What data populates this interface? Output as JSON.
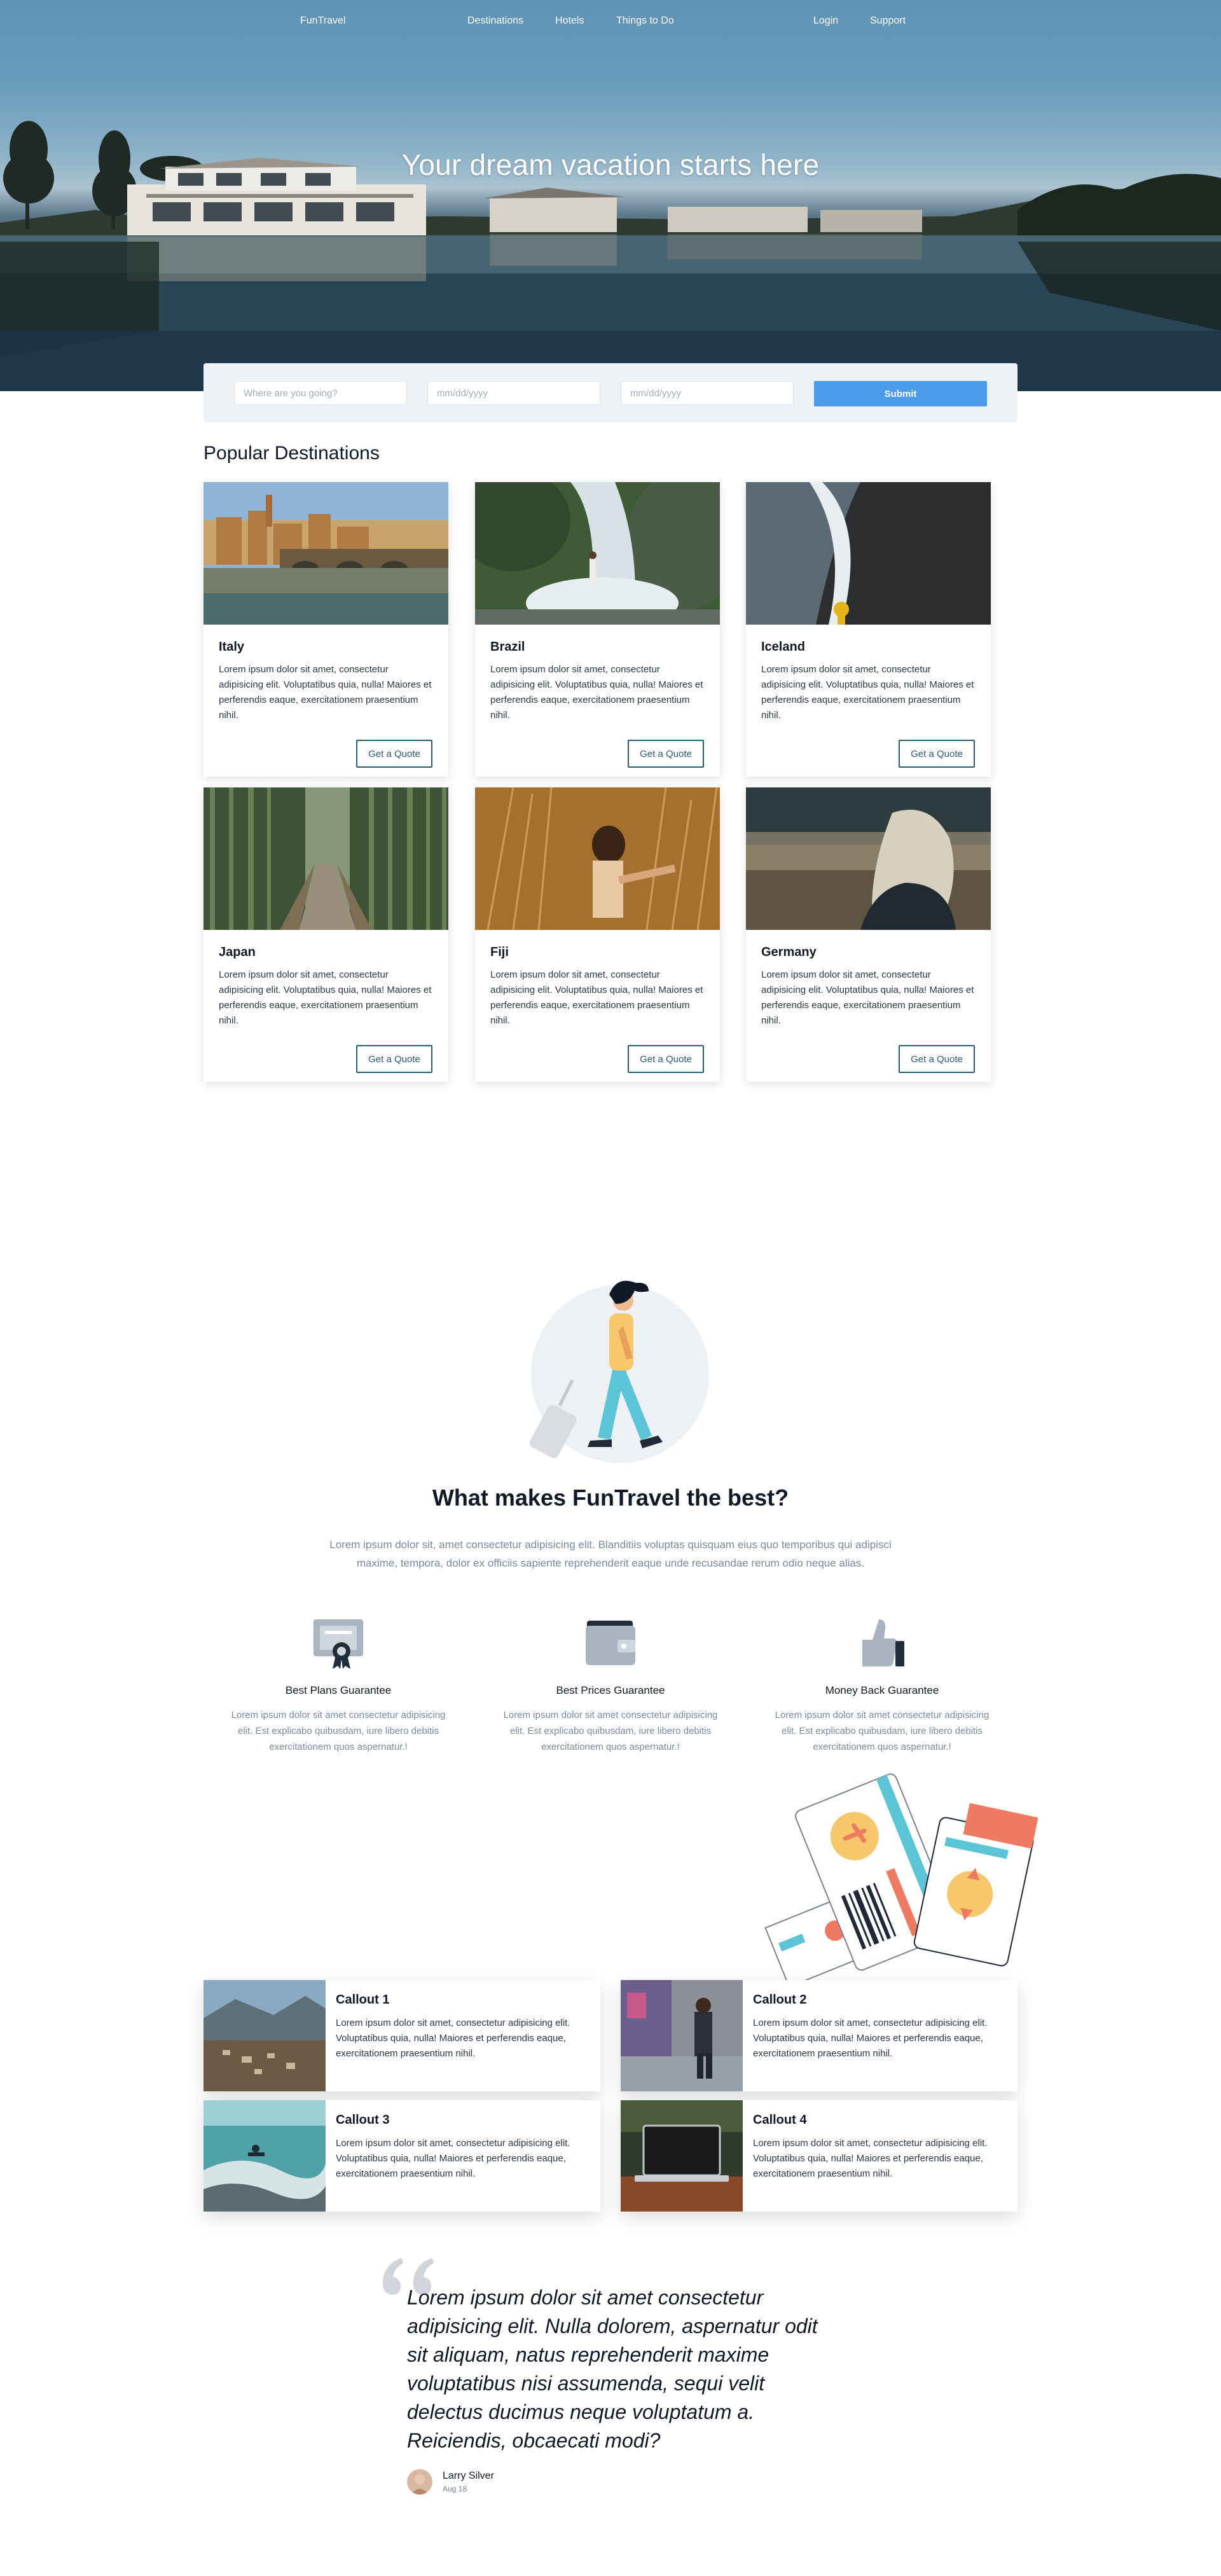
{
  "nav": {
    "brand": "FunTravel",
    "links": [
      "Destinations",
      "Hotels",
      "Things to Do"
    ],
    "right": [
      "Login",
      "Support"
    ]
  },
  "hero": {
    "title": "Your dream vacation starts here"
  },
  "search": {
    "where_placeholder": "Where are you going?",
    "checkin_placeholder": "mm/dd/yyyy",
    "checkout_placeholder": "mm/dd/yyyy",
    "submit_label": "Submit"
  },
  "destinations": {
    "title": "Popular Destinations",
    "button_label": "Get a Quote",
    "items": [
      {
        "name": "Italy",
        "text": "Lorem ipsum dolor sit amet, consectetur adipisicing elit. Voluptatibus quia, nulla! Maiores et perferendis eaque, exercitationem praesentium nihil."
      },
      {
        "name": "Brazil",
        "text": "Lorem ipsum dolor sit amet, consectetur adipisicing elit. Voluptatibus quia, nulla! Maiores et perferendis eaque, exercitationem praesentium nihil."
      },
      {
        "name": "Iceland",
        "text": "Lorem ipsum dolor sit amet, consectetur adipisicing elit. Voluptatibus quia, nulla! Maiores et perferendis eaque, exercitationem praesentium nihil."
      },
      {
        "name": "Japan",
        "text": "Lorem ipsum dolor sit amet, consectetur adipisicing elit. Voluptatibus quia, nulla! Maiores et perferendis eaque, exercitationem praesentium nihil."
      },
      {
        "name": "Fiji",
        "text": "Lorem ipsum dolor sit amet, consectetur adipisicing elit. Voluptatibus quia, nulla! Maiores et perferendis eaque, exercitationem praesentium nihil."
      },
      {
        "name": "Germany",
        "text": "Lorem ipsum dolor sit amet, consectetur adipisicing elit. Voluptatibus quia, nulla! Maiores et perferendis eaque, exercitationem praesentium nihil."
      }
    ]
  },
  "features": {
    "title": "What makes FunTravel the best?",
    "description": "Lorem ipsum dolor sit, amet consectetur adipisicing elit. Blanditiis voluptas quisquam eius quo temporibus qui adipisci maxime, tempora, dolor ex officiis sapiente reprehenderit eaque unde recusandae rerum odio neque alias.",
    "items": [
      {
        "title": "Best Plans Guarantee",
        "text": "Lorem ipsum dolor sit amet consectetur adipisicing elit. Est explicabo quibusdam, iure libero debitis exercitationem quos aspernatur.!",
        "icon": "certificate-icon"
      },
      {
        "title": "Best Prices Guarantee",
        "text": "Lorem ipsum dolor sit amet consectetur adipisicing elit. Est explicabo quibusdam, iure libero debitis exercitationem quos aspernatur.!",
        "icon": "wallet-icon"
      },
      {
        "title": "Money Back Guarantee",
        "text": "Lorem ipsum dolor sit amet consectetur adipisicing elit. Est explicabo quibusdam, iure libero debitis exercitationem quos aspernatur.!",
        "icon": "thumbs-up-icon"
      }
    ]
  },
  "callouts": [
    {
      "title": "Callout 1",
      "text": "Lorem ipsum dolor sit amet, consectetur adipisicing elit. Voluptatibus quia, nulla! Maiores et perferendis eaque, exercitationem praesentium nihil."
    },
    {
      "title": "Callout 2",
      "text": "Lorem ipsum dolor sit amet, consectetur adipisicing elit. Voluptatibus quia, nulla! Maiores et perferendis eaque, exercitationem praesentium nihil."
    },
    {
      "title": "Callout 3",
      "text": "Lorem ipsum dolor sit amet, consectetur adipisicing elit. Voluptatibus quia, nulla! Maiores et perferendis eaque, exercitationem praesentium nihil."
    },
    {
      "title": "Callout 4",
      "text": "Lorem ipsum dolor sit amet, consectetur adipisicing elit. Voluptatibus quia, nulla! Maiores et perferendis eaque, exercitationem praesentium nihil."
    }
  ],
  "testimonial": {
    "quote": "Lorem ipsum dolor sit amet consectetur adipisicing elit. Nulla dolorem, aspernatur odit sit aliquam, natus reprehenderit maxime voluptatibus nisi assumenda, sequi velit delectus ducimus neque voluptatum a. Reiciendis, obcaecati modi?",
    "author": "Larry Silver",
    "date": "Aug 18"
  },
  "colors": {
    "accent": "#4c9be8",
    "quote_button_border": "#2c5c70",
    "section_bg": "#f4f7fa",
    "muted_text": "#7a8aa0"
  }
}
